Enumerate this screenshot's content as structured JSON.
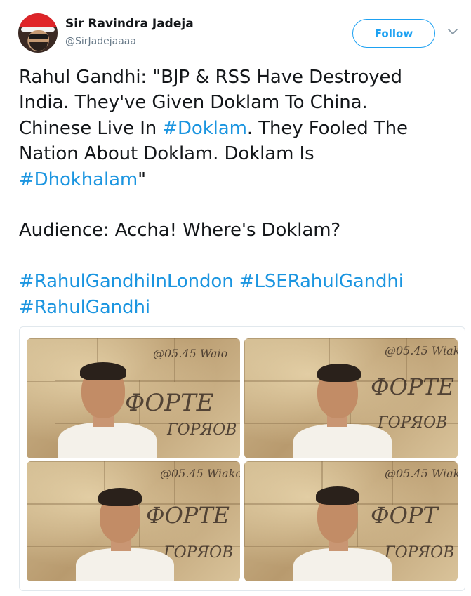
{
  "user": {
    "name": "Sir Ravindra Jadeja",
    "handle": "@SirJadejaaaa"
  },
  "follow_label": "Follow",
  "tweet": {
    "line1": "Rahul Gandhi: \"BJP & RSS Have Destroyed",
    "line2": "India. They've Given Doklam To China.",
    "line3_a": "Chinese Live In ",
    "line3_tag": "#Doklam",
    "line3_b": ". They Fooled The",
    "line4": "Nation About Doklam. Doklam Is",
    "line5_tag": "#Dhokhalam",
    "line5_b": "\"",
    "line6": "Audience: Accha! Where's Doklam?",
    "tag1": "#RahulGandhiInLondon",
    "tag2": "#LSERahulGandhi",
    "tag3": "#RahulGandhi"
  },
  "photos": [
    {
      "id": "photo-1"
    },
    {
      "id": "photo-2"
    },
    {
      "id": "photo-3"
    },
    {
      "id": "photo-4"
    }
  ],
  "colors": {
    "accent": "#1da1f2",
    "hashtag": "#1b95e0",
    "text": "#14171a",
    "muted": "#657786",
    "border": "#e1e8ed"
  },
  "icons": [
    "avatar",
    "chevron-down-icon"
  ]
}
